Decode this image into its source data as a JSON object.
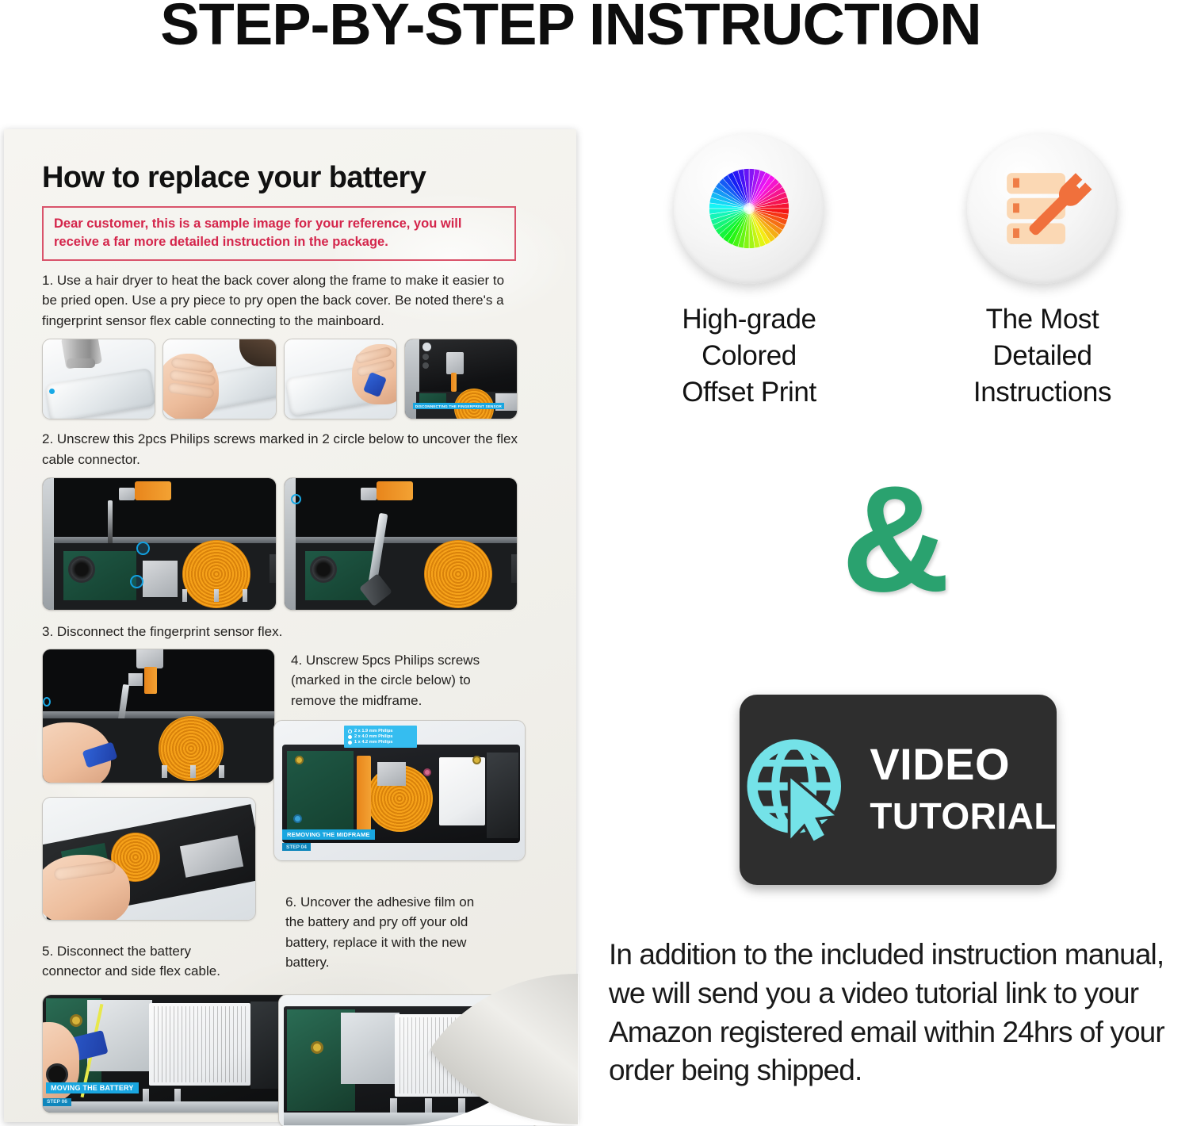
{
  "header": {
    "title": "STEP-BY-STEP INSTRUCTION"
  },
  "sheet": {
    "heading": "How to replace your battery",
    "notice": "Dear customer, this is a sample image for your reference, you will receive a far more detailed instruction in the package.",
    "steps": [
      {
        "number": "1",
        "text": "1. Use a hair dryer to heat the back cover along the frame to make it easier to be pried open. Use a pry piece to pry open the back cover. Be noted there's a fingerprint sensor flex cable connecting to the mainboard."
      },
      {
        "number": "2",
        "text": "2. Unscrew this 2pcs Philips screws marked in 2 circle below to uncover the flex cable connector."
      },
      {
        "number": "3",
        "text": "3. Disconnect the fingerprint sensor flex."
      },
      {
        "number": "4",
        "text": "4. Unscrew 5pcs Philips screws (marked in the circle below) to remove the midframe."
      },
      {
        "number": "5",
        "text": "5. Disconnect the battery connector and side flex cable."
      },
      {
        "number": "6",
        "text": "6. Uncover the adhesive film on the battery and pry off your old battery, replace it with the new battery."
      }
    ],
    "photo_captions": {
      "fingerprint": "DISCONNECTING THE FINGERPRINT SENSOR",
      "midframe": "REMOVING THE MIDFRAME",
      "midframe_step": "STEP 04",
      "battery": "MOVING THE BATTERY",
      "battery_step": "STEP 06"
    },
    "screw_legend": [
      {
        "label": "2 x 1.9 mm Philips"
      },
      {
        "label": "2 x 4.0 mm Philips"
      },
      {
        "label": "1 x 4.2 mm Philips"
      }
    ]
  },
  "features": [
    {
      "icon": "color-wheel-icon",
      "line1": "High-grade",
      "line2": "Colored",
      "line3": "Offset Print"
    },
    {
      "icon": "server-wrench-icon",
      "line1": "The Most",
      "line2": "Detailed",
      "line3": "Instructions"
    }
  ],
  "ampersand": "&",
  "video_card": {
    "icon": "globe-cursor-icon",
    "line1": "VIDEO",
    "line2": "TUTORIAL"
  },
  "bottom_note": "In addition to the included instruction manual, we will send you a video tutorial link to your Amazon registered email within 24hrs of your order being shipped.",
  "colors": {
    "title": "#0d0d0d",
    "notice_red": "#d4254b",
    "ampersand_green": "#2aa26f",
    "video_card_bg": "#2e2e2e",
    "video_icon_cyan": "#74e2e8",
    "tag_blue": "#19a6e0",
    "wrench_orange": "#f0703c"
  }
}
